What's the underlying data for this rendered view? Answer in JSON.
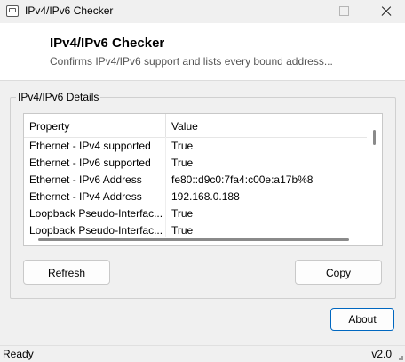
{
  "window": {
    "title": "IPv4/IPv6 Checker"
  },
  "header": {
    "title": "IPv4/IPv6 Checker",
    "subtitle": "Confirms IPv4/IPv6 support and lists every bound address..."
  },
  "group": {
    "label": "IPv4/IPv6 Details"
  },
  "table": {
    "columns": [
      "Property",
      "Value"
    ],
    "rows": [
      {
        "property": "Ethernet - IPv4 supported",
        "value": "True"
      },
      {
        "property": "Ethernet - IPv6 supported",
        "value": "True"
      },
      {
        "property": "Ethernet - IPv6 Address",
        "value": "fe80::d9c0:7fa4:c00e:a17b%8"
      },
      {
        "property": "Ethernet - IPv4 Address",
        "value": "192.168.0.188"
      },
      {
        "property": "Loopback Pseudo-Interfac...",
        "value": "True"
      },
      {
        "property": "Loopback Pseudo-Interfac...",
        "value": "True"
      }
    ]
  },
  "buttons": {
    "refresh": "Refresh",
    "copy": "Copy",
    "about": "About"
  },
  "status": {
    "text": "Ready",
    "version": "v2.0"
  },
  "colors": {
    "accent": "#0067c0",
    "header_bg": "#ffffff",
    "window_bg": "#f0f0f0"
  }
}
